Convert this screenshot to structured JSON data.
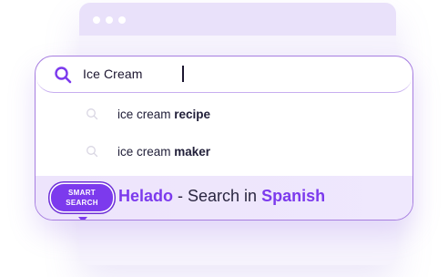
{
  "search": {
    "value": "Ice Cream"
  },
  "suggestions": [
    {
      "prefix": "ice cream ",
      "suffix": "recipe"
    },
    {
      "prefix": "ice cream ",
      "suffix": "maker"
    }
  ],
  "smart_search": {
    "badge_line1": "SMART",
    "badge_line2": "SEARCH",
    "term": "Helado",
    "middle": " - Search in ",
    "language": "Spanish"
  },
  "icons": {
    "main_search": "search-icon",
    "suggestion_search": "search-icon",
    "window_dots": "window-control-dots"
  },
  "colors": {
    "accent": "#7c3aed",
    "border": "#a77ee0",
    "highlight_row": "#ede4fc"
  }
}
